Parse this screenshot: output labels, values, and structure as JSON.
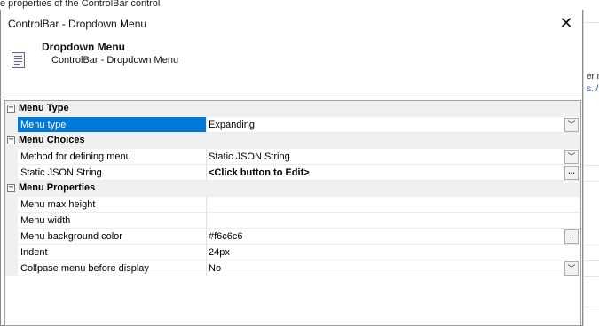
{
  "background": {
    "caption": "e properties of the ControlBar control",
    "right_fragments": [
      "er mo",
      "s. /"
    ]
  },
  "dialog": {
    "title": "ControlBar - Dropdown Menu",
    "close_glyph": "✕",
    "header": {
      "title": "Dropdown Menu",
      "subtitle": "ControlBar - Dropdown Menu",
      "icon": "document-icon"
    }
  },
  "grid": {
    "categories": [
      {
        "label": "Menu Type",
        "toggle": "−",
        "properties": [
          {
            "name": "Menu type",
            "value": "Expanding",
            "editor": "dropdown",
            "selected": true
          }
        ]
      },
      {
        "label": "Menu Choices",
        "toggle": "−",
        "properties": [
          {
            "name": "Method for defining menu",
            "value": "Static JSON String",
            "editor": "dropdown"
          },
          {
            "name": "Static JSON String",
            "value": "<Click button to Edit>",
            "editor": "ellipsis",
            "bold": true
          }
        ]
      },
      {
        "label": "Menu Properties",
        "toggle": "−",
        "properties": [
          {
            "name": "Menu max height",
            "value": "",
            "editor": "none"
          },
          {
            "name": "Menu width",
            "value": "",
            "editor": "none"
          },
          {
            "name": "Menu background color",
            "value": "#f6c6c6",
            "editor": "ellipsis"
          },
          {
            "name": "Indent",
            "value": "24px",
            "editor": "none"
          },
          {
            "name": "Collpase menu before display",
            "value": "No",
            "editor": "dropdown"
          }
        ]
      }
    ],
    "dropdown_glyph": "﹀",
    "ellipsis_glyph": "...",
    "colors": {
      "selection": "#0078d7",
      "category_bg": "#f0f0f0"
    }
  }
}
